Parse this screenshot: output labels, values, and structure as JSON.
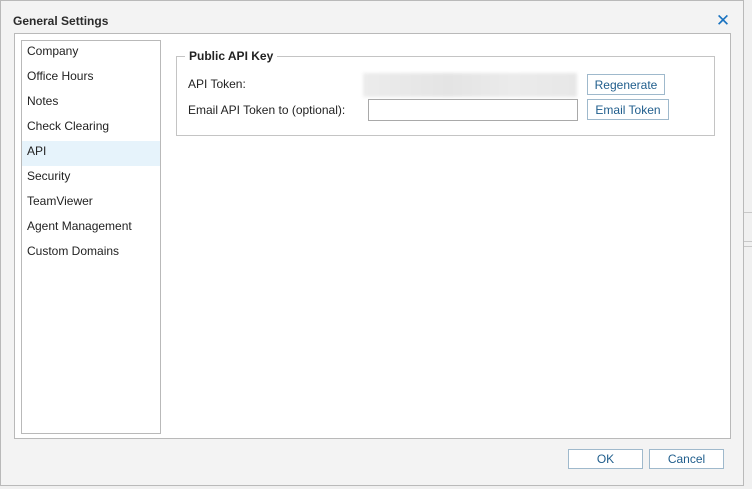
{
  "dialog": {
    "title": "General Settings",
    "close_glyph": "✕"
  },
  "sidebar": {
    "items": [
      {
        "label": "Company",
        "active": false
      },
      {
        "label": "Office Hours",
        "active": false
      },
      {
        "label": "Notes",
        "active": false
      },
      {
        "label": "Check Clearing",
        "active": false
      },
      {
        "label": "API",
        "active": true
      },
      {
        "label": "Security",
        "active": false
      },
      {
        "label": "TeamViewer",
        "active": false
      },
      {
        "label": "Agent Management",
        "active": false
      },
      {
        "label": "Custom Domains",
        "active": false
      }
    ]
  },
  "api_panel": {
    "legend": "Public API Key",
    "token_label": "API Token:",
    "email_label": "Email API Token to (optional):",
    "email_value": "",
    "regenerate_label": "Regenerate",
    "email_token_label": "Email Token"
  },
  "footer": {
    "ok_label": "OK",
    "cancel_label": "Cancel"
  },
  "colors": {
    "accent": "#1a73c0",
    "button_text": "#1f5d8c",
    "active_item_bg": "#e6f3fb"
  }
}
